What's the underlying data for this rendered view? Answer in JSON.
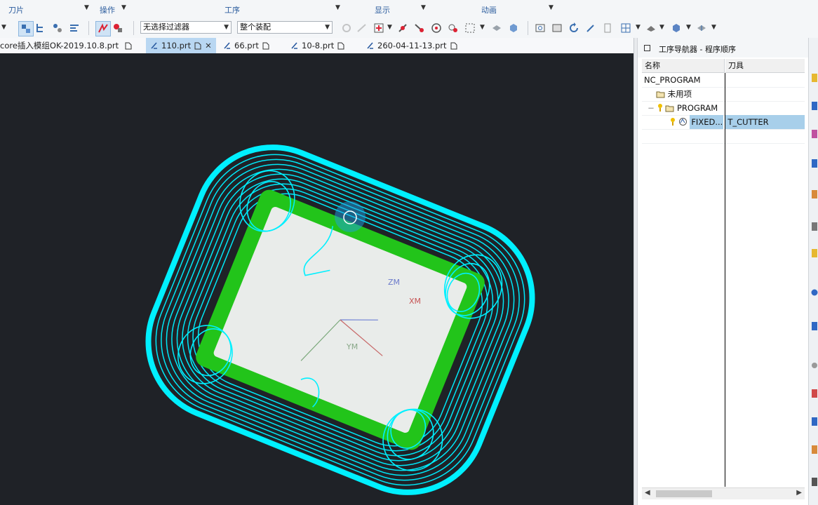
{
  "ribbon": {
    "groups": [
      {
        "label": "刀片"
      },
      {
        "label": "操作"
      },
      {
        "label": "工序"
      },
      {
        "label": "显示"
      },
      {
        "label": "动画"
      }
    ]
  },
  "toolbar": {
    "filter_combo": "无选择过滤器",
    "assembly_combo": "整个装配"
  },
  "tabs": [
    {
      "label": "core插入模组OK-2019.10.8.prt"
    },
    {
      "label": "110.prt",
      "active": true
    },
    {
      "label": "66.prt"
    },
    {
      "label": "10-8.prt"
    },
    {
      "label": "260-04-11-13.prt"
    }
  ],
  "viewport": {
    "axis_labels": {
      "zm": "ZM",
      "xm": "XM",
      "ym": "YM"
    },
    "colors": {
      "background": "#1f2227",
      "toolpath": "#00f0ff",
      "part_wall": "#22c41a",
      "part_floor": "#e9ecea"
    }
  },
  "navigator": {
    "title": "工序导航器 - 程序顺序",
    "columns": {
      "name": "名称",
      "tool": "刀具"
    },
    "rows": [
      {
        "name": "NC_PROGRAM",
        "tool": ""
      },
      {
        "name": "未用项",
        "tool": ""
      },
      {
        "name": "PROGRAM",
        "tool": ""
      },
      {
        "name": "FIXED...",
        "tool": "T_CUTTER",
        "selected": true
      }
    ]
  }
}
